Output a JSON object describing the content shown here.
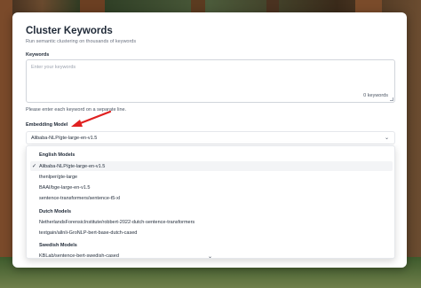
{
  "page": {
    "title": "Cluster Keywords",
    "subtitle": "Run semantic clustering on thousands of keywords"
  },
  "keywords": {
    "label": "Keywords",
    "placeholder": "Enter your keywords",
    "count": "0 keywords",
    "hint": "Please enter each keyword on a separate line."
  },
  "embedding": {
    "label": "Embedding Model",
    "selected": "Alibaba-NLP/gte-large-en-v1.5",
    "groups": [
      {
        "name": "English Models",
        "options": [
          "Alibaba-NLP/gte-large-en-v1.5",
          "thenlper/gte-large",
          "BAAI/bge-large-en-v1.5",
          "sentence-transformers/sentence-t5-xl"
        ]
      },
      {
        "name": "Dutch Models",
        "options": [
          "NetherlandsForensicInstitute/robbert-2022-dutch-sentence-transformers",
          "textgain/allnli-GroNLP-bert-base-dutch-cased"
        ]
      },
      {
        "name": "Swedish Models",
        "options": [
          "KBLab/sentence-bert-swedish-cased"
        ]
      }
    ]
  },
  "colors": {
    "annotation_arrow": "#e02020",
    "selected_option_bg": "#f3f4f6"
  },
  "icons": {
    "dropdown": "chevron-down-icon",
    "selected": "check-icon",
    "scroll": "chevron-down-icon"
  }
}
